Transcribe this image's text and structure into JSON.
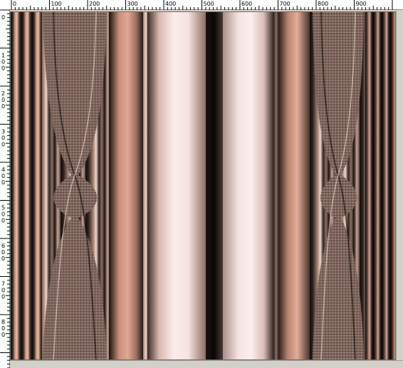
{
  "rulers": {
    "top_labels": [
      "0",
      "100",
      "200",
      "300",
      "400",
      "500",
      "600",
      "700",
      "800",
      "900"
    ],
    "left_labels": [
      "0",
      "100",
      "200",
      "300",
      "400",
      "500",
      "600",
      "700",
      "800"
    ]
  },
  "canvas": {
    "description_colors": {
      "dark": "#120d0b",
      "brown": "#6d5a52",
      "tan": "#c4a294",
      "salmon": "#d7a08a",
      "pale_pink": "#f7e3e0"
    }
  }
}
